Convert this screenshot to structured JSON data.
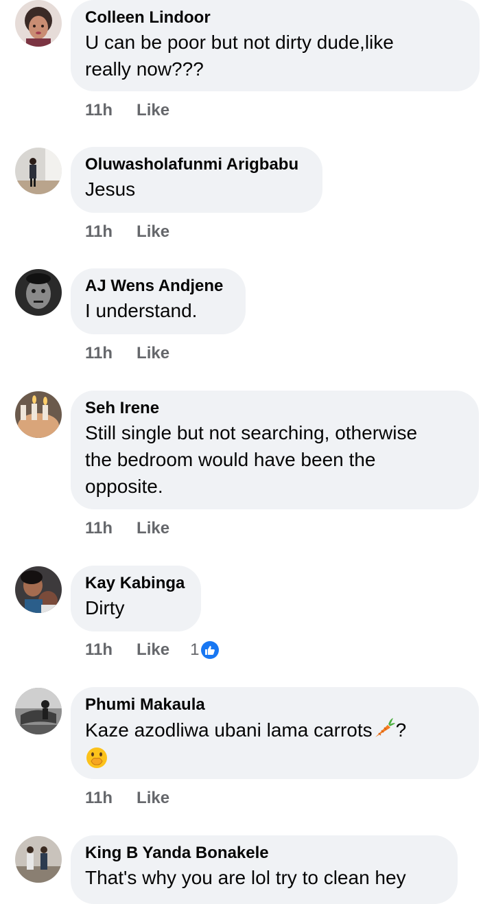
{
  "comments": [
    {
      "author": "Colleen Lindoor",
      "lines": [
        "U can be poor but not dirty dude,like",
        "really now???"
      ],
      "time": "11h",
      "like_label": "Like"
    },
    {
      "author": "Oluwasholafunmi Arigbabu",
      "lines": [
        "Jesus"
      ],
      "time": "11h",
      "like_label": "Like"
    },
    {
      "author": "AJ Wens Andjene",
      "lines": [
        "I understand."
      ],
      "time": "11h",
      "like_label": "Like"
    },
    {
      "author": "Seh Irene",
      "lines": [
        "Still single but not searching, otherwise",
        "the bedroom would have been the",
        "opposite."
      ],
      "time": "11h",
      "like_label": "Like"
    },
    {
      "author": "Kay Kabinga",
      "lines": [
        "Dirty"
      ],
      "time": "11h",
      "like_label": "Like",
      "reaction_count": "1",
      "reaction_icon": "thumbs-up-icon"
    },
    {
      "author": "Phumi Makaula",
      "lines": [
        "Kaze azodliwa ubani lama carrots",
        "?"
      ],
      "emojis": [
        "carrot-emoji",
        "hand-over-mouth-emoji"
      ],
      "time": "11h",
      "like_label": "Like"
    },
    {
      "author": "King B Yanda Bonakele",
      "lines": [
        "That's why you are lol try to clean hey"
      ]
    }
  ],
  "colors": {
    "bubble": "#f0f2f5",
    "meta_text": "#65676b",
    "like_blue": "#1877f2",
    "text": "#050505"
  }
}
